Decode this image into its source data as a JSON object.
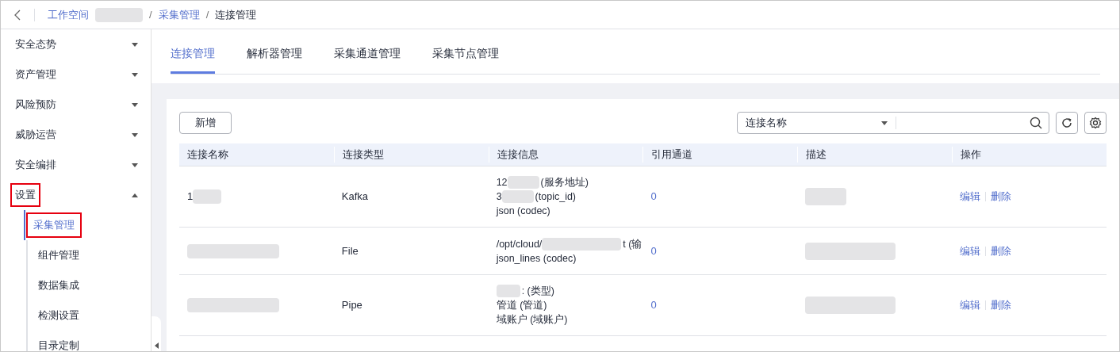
{
  "breadcrumb": {
    "items": [
      {
        "label": "工作空间",
        "redacted": true,
        "current": false
      },
      {
        "separator": "/",
        "label": "采集管理",
        "redacted": false,
        "current": false
      },
      {
        "separator": "/",
        "label": "连接管理",
        "redacted": false,
        "current": true
      }
    ]
  },
  "sidebar": {
    "items": [
      {
        "label": "安全态势",
        "expanded": false,
        "highlighted": false
      },
      {
        "label": "资产管理",
        "expanded": false,
        "highlighted": false
      },
      {
        "label": "风险预防",
        "expanded": false,
        "highlighted": false
      },
      {
        "label": "威胁运营",
        "expanded": false,
        "highlighted": false
      },
      {
        "label": "安全编排",
        "expanded": false,
        "highlighted": false
      },
      {
        "label": "设置",
        "expanded": true,
        "highlighted": true,
        "children": [
          {
            "label": "采集管理",
            "selected": true,
            "highlighted": true
          },
          {
            "label": "组件管理",
            "selected": false,
            "highlighted": false
          },
          {
            "label": "数据集成",
            "selected": false,
            "highlighted": false
          },
          {
            "label": "检测设置",
            "selected": false,
            "highlighted": false
          },
          {
            "label": "目录定制",
            "selected": false,
            "highlighted": false
          }
        ]
      }
    ]
  },
  "tabs": [
    {
      "label": "连接管理",
      "selected": true
    },
    {
      "label": "解析器管理",
      "selected": false
    },
    {
      "label": "采集通道管理",
      "selected": false
    },
    {
      "label": "采集节点管理",
      "selected": false
    }
  ],
  "toolbar": {
    "add_button": "新增",
    "search_filter": "连接名称"
  },
  "table": {
    "columns": [
      "连接名称",
      "连接类型",
      "连接信息",
      "引用通道",
      "描述",
      "操作"
    ],
    "rows": [
      {
        "name": {
          "prefix": "1",
          "redacted": true
        },
        "type": "Kafka",
        "info": [
          {
            "prefix": "12",
            "redacted": true,
            "suffix": "(服务地址)"
          },
          {
            "prefix": "3",
            "redacted": true,
            "suffix": "(topic_id)"
          },
          {
            "prefix": "json (codec)",
            "redacted": false
          }
        ],
        "channels": "0",
        "description_redacted": true,
        "actions": [
          "编辑",
          "删除"
        ]
      },
      {
        "name": {
          "redacted": true
        },
        "type": "File",
        "info": [
          {
            "prefix": "/opt/cloud/",
            "redacted": true,
            "suffix": "t (输"
          },
          {
            "prefix": "json_lines (codec)",
            "redacted": false
          }
        ],
        "channels": "0",
        "description_redacted": true,
        "actions": [
          "编辑",
          "删除"
        ]
      },
      {
        "name": {
          "redacted": true
        },
        "type": "Pipe",
        "info": [
          {
            "redacted": true,
            "suffix": ": (类型)"
          },
          {
            "prefix": "管道 (管道)",
            "redacted": false
          },
          {
            "prefix": "域账户 (域账户)",
            "redacted": false
          }
        ],
        "channels": "0",
        "description_redacted": true,
        "actions": [
          "编辑",
          "删除"
        ]
      }
    ]
  }
}
